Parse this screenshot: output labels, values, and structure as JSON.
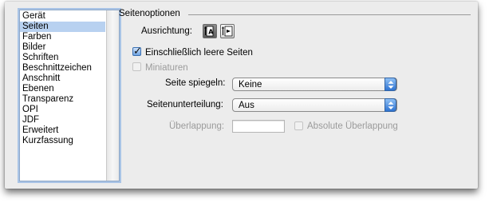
{
  "categories": [
    {
      "label": "Gerät",
      "selected": false
    },
    {
      "label": "Seiten",
      "selected": true
    },
    {
      "label": "Farben",
      "selected": false
    },
    {
      "label": "Bilder",
      "selected": false
    },
    {
      "label": "Schriften",
      "selected": false
    },
    {
      "label": "Beschnittzeichen",
      "selected": false
    },
    {
      "label": "Anschnitt",
      "selected": false
    },
    {
      "label": "Ebenen",
      "selected": false
    },
    {
      "label": "Transparenz",
      "selected": false
    },
    {
      "label": "OPI",
      "selected": false
    },
    {
      "label": "JDF",
      "selected": false
    },
    {
      "label": "Erweitert",
      "selected": false
    },
    {
      "label": "Kurzfassung",
      "selected": false
    }
  ],
  "section": {
    "title": "Seitenoptionen"
  },
  "orientation": {
    "label": "Ausrichtung:",
    "options": [
      {
        "icon": "orientation-portrait-icon",
        "active": true
      },
      {
        "icon": "orientation-rotated-icon",
        "active": false
      }
    ]
  },
  "include_blank_pages": {
    "label": "Einschließlich leere Seiten",
    "checked": true
  },
  "thumbnails": {
    "label": "Miniaturen",
    "checked": false,
    "enabled": false
  },
  "mirror_page": {
    "label": "Seite spiegeln:",
    "value": "Keine"
  },
  "tiling": {
    "label": "Seitenunterteilung:",
    "value": "Aus"
  },
  "overlap": {
    "label": "Überlappung:",
    "value": "",
    "enabled": false
  },
  "absolute_overlap": {
    "label": "Absolute Überlappung",
    "checked": false,
    "enabled": false
  },
  "colors": {
    "selection": "#b8d1f0",
    "focus_ring": "#a9c4e6",
    "popup_accent": "#2e73d1",
    "panel_bg": "#ececec"
  }
}
